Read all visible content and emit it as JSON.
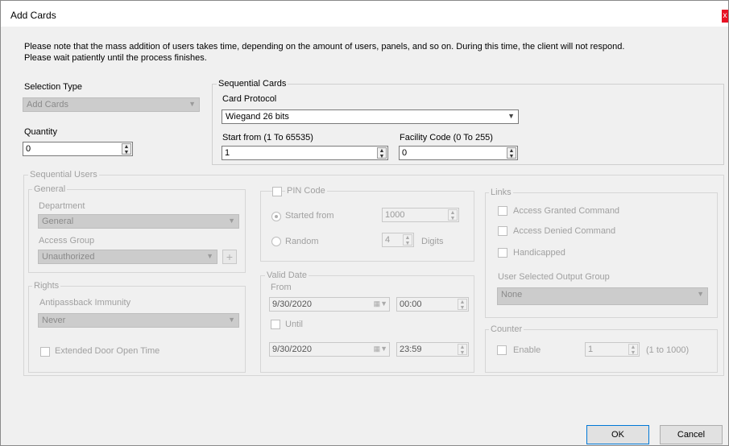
{
  "window": {
    "title": "Add Cards",
    "close_glyph": "x"
  },
  "note": "Please note that the mass addition of users takes time, depending on the amount of users, panels, and so on. During this time, the client will not respond. Please wait patiently until the process finishes.",
  "selection_type": {
    "label": "Selection Type",
    "value": "Add Cards"
  },
  "quantity": {
    "label": "Quantity",
    "value": "0"
  },
  "sequential_cards": {
    "title": "Sequential Cards",
    "protocol_label": "Card Protocol",
    "protocol_value": "Wiegand 26 bits",
    "start_label": "Start from (1 To 65535)",
    "start_value": "1",
    "facility_label": "Facility Code (0 To 255)",
    "facility_value": "0"
  },
  "sequential_users": {
    "title": "Sequential Users",
    "general": {
      "title": "General",
      "department_label": "Department",
      "department_value": "General",
      "access_group_label": "Access Group",
      "access_group_value": "Unauthorized",
      "add_glyph": "+"
    },
    "rights": {
      "title": "Rights",
      "antipassback_label": "Antipassback Immunity",
      "antipassback_value": "Never",
      "extended_door_label": "Extended Door Open Time"
    },
    "pin": {
      "title": "PIN Code",
      "started_from_label": "Started from",
      "started_from_value": "1000",
      "random_label": "Random",
      "digits_value": "4",
      "digits_label": "Digits"
    },
    "valid_date": {
      "title": "Valid Date",
      "from_label": "From",
      "from_date": "9/30/2020",
      "from_time": "00:00",
      "until_label": "Until",
      "until_date": "9/30/2020",
      "until_time": "23:59"
    },
    "links": {
      "title": "Links",
      "access_granted_label": "Access Granted Command",
      "access_denied_label": "Access Denied Command",
      "handicapped_label": "Handicapped",
      "output_group_label": "User Selected Output Group",
      "output_group_value": "None"
    },
    "counter": {
      "title": "Counter",
      "enable_label": "Enable",
      "value": "1",
      "range_label": "(1 to 1000)"
    }
  },
  "buttons": {
    "ok": "OK",
    "cancel": "Cancel"
  }
}
